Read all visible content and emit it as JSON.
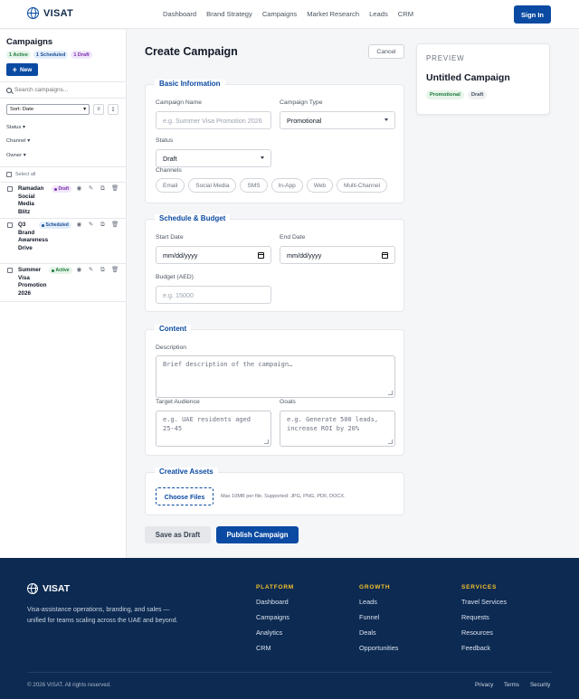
{
  "header": {
    "logo_text": "VISAT",
    "nav": [
      "Dashboard",
      "Brand Strategy",
      "Campaigns",
      "Market Research",
      "Leads",
      "CRM"
    ],
    "signin_label": "Sign In"
  },
  "sidebar": {
    "title": "Campaigns",
    "pills": {
      "active": "1 Active",
      "scheduled": "1 Scheduled",
      "draft": "1 Draft"
    },
    "new_label": "New",
    "search_placeholder": "Search campaigns...",
    "sort_label": "Sort: Date",
    "filters": {
      "status": "Status",
      "channel": "Channel",
      "owner": "Owner"
    },
    "select_all": "Select all",
    "campaigns": [
      {
        "name": "Ramadan Social Media Blitz",
        "status": "Draft"
      },
      {
        "name": "Q3 Brand Awareness Drive",
        "status": "Scheduled"
      },
      {
        "name": "Summer Visa Promotion 2026",
        "status": "Active"
      }
    ]
  },
  "main": {
    "title": "Create Campaign",
    "cancel_label": "Cancel",
    "basic": {
      "legend": "Basic Information",
      "name_label": "Campaign Name",
      "name_placeholder": "e.g. Summer Visa Promotion 2026",
      "type_label": "Campaign Type",
      "type_value": "Promotional",
      "status_label": "Status",
      "status_value": "Draft",
      "channels_label": "Channels",
      "channels": [
        "Email",
        "Social Media",
        "SMS",
        "In-App",
        "Web",
        "Multi-Channel"
      ]
    },
    "schedule": {
      "legend": "Schedule & Budget",
      "start_label": "Start Date",
      "start_placeholder": "mm/dd/yyyy",
      "end_label": "End Date",
      "end_placeholder": "mm/dd/yyyy",
      "budget_label": "Budget (AED)",
      "budget_placeholder": "e.g. 15000"
    },
    "content": {
      "legend": "Content",
      "description_label": "Description",
      "description_placeholder": "Brief description of the campaign…",
      "audience_label": "Target Audience",
      "audience_placeholder": "e.g. UAE residents aged 25-45",
      "goals_label": "Goals",
      "goals_placeholder": "e.g. Generate 500 leads, increase ROI by 20%"
    },
    "assets": {
      "legend": "Creative Assets",
      "choose_label": "Choose Files",
      "hint": "Max 10MB per file. Supported: JPG, PNG, PDF, DOCX."
    },
    "save_draft_label": "Save as Draft",
    "publish_label": "Publish Campaign"
  },
  "preview": {
    "heading": "PREVIEW",
    "title": "Untitled Campaign",
    "badges": [
      "Promotional",
      "Draft"
    ]
  },
  "footer": {
    "logo_text": "VISAT",
    "tagline": "Visa-assistance operations, branding, and sales — unified for teams scaling across the UAE and beyond.",
    "columns": [
      {
        "heading": "PLATFORM",
        "links": [
          "Dashboard",
          "Campaigns",
          "Analytics",
          "CRM"
        ]
      },
      {
        "heading": "GROWTH",
        "links": [
          "Leads",
          "Funnel",
          "Deals",
          "Opportunities"
        ]
      },
      {
        "heading": "SERVICES",
        "links": [
          "Travel Services",
          "Requests",
          "Resources",
          "Feedback"
        ]
      }
    ],
    "copyright": "© 2026 VISAT. All rights reserved.",
    "legal": [
      "Privacy",
      "Terms",
      "Security"
    ]
  },
  "colors": {
    "primary": "#0b4aa2",
    "footer_bg": "#0c2a52",
    "footer_heading": "#f5c02b"
  }
}
